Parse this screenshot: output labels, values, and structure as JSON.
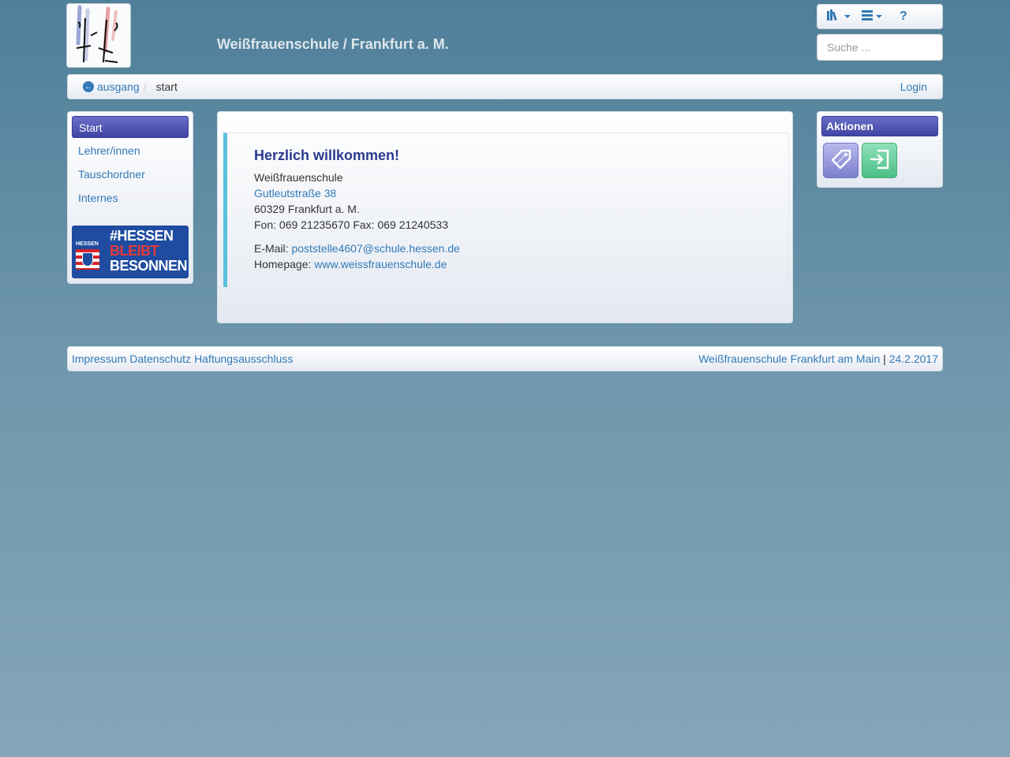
{
  "header": {
    "site_title": "Weißfrauenschule / Frankfurt a. M.",
    "search_placeholder": "Suche ..."
  },
  "tools": {
    "help_label": "?"
  },
  "breadcrumb": {
    "back_label": "ausgang",
    "current": "start",
    "login_label": "Login"
  },
  "sidebar": {
    "items": [
      {
        "label": "Start",
        "active": true
      },
      {
        "label": "Lehrer/innen"
      },
      {
        "label": "Tauschordner"
      },
      {
        "label": "Internes"
      }
    ],
    "banner": {
      "small": "HESSEN",
      "line1": "#HESSEN",
      "line2": "BLEIBT",
      "line3": "BESONNEN"
    }
  },
  "main": {
    "heading": "Herzlich willkommen!",
    "school": "Weißfrauenschule",
    "street": "Gutleutstraße 38",
    "city": "60329 Frankfurt a. M.",
    "phone": "Fon: 069 21235670 Fax: 069 21240533",
    "email_label": "E-Mail: ",
    "email": "poststelle4607@schule.hessen.de",
    "homepage_label": "Homepage: ",
    "homepage": "www.weissfrauenschule.de"
  },
  "actions": {
    "title": "Aktionen"
  },
  "footer": {
    "impressum": "Impressum",
    "datenschutz": "Datenschutz",
    "haftung": "Haftungsausschluss",
    "school_link": "Weißfrauenschule Frankfurt am Main",
    "separator": "|",
    "date": "24.2.2017"
  }
}
